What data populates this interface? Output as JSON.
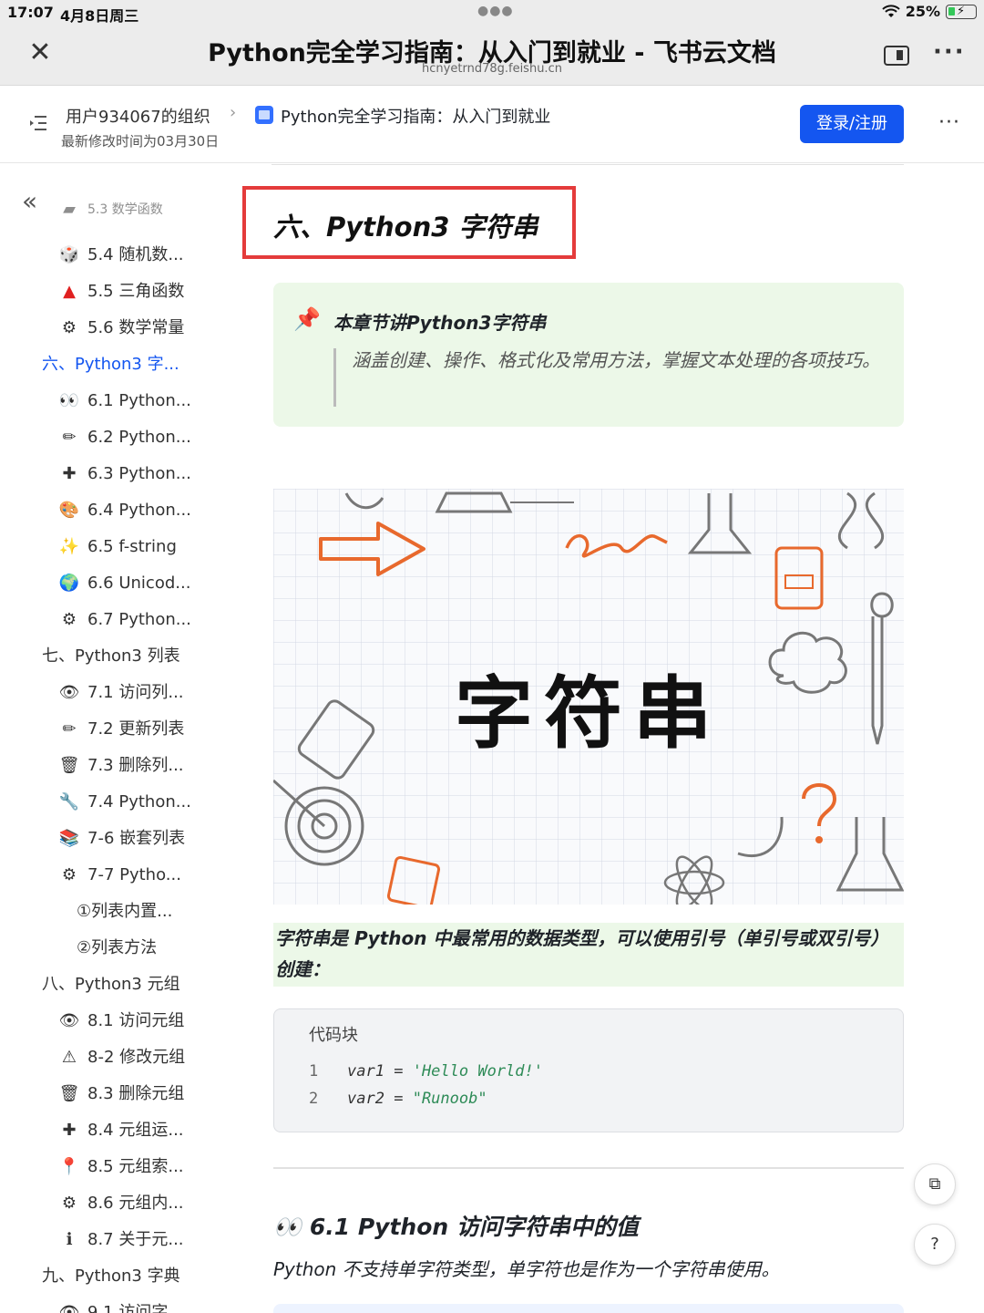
{
  "status_bar": {
    "time": "17:07",
    "date": "4月8日周三",
    "battery": "25%"
  },
  "window": {
    "title": "Python完全学习指南：从入门到就业 - 飞书云文档",
    "url": "hcnyetrnd78g.feishu.cn"
  },
  "doc_header": {
    "org": "用户934067的组织",
    "doc_name": "Python完全学习指南：从入门到就业",
    "modified": "最新修改时间为03月30日",
    "login": "登录/注册"
  },
  "sidebar": {
    "items": [
      {
        "icon": "🎲",
        "label": "5.4 随机数..."
      },
      {
        "icon": "▲",
        "label": "5.5 三角函数"
      },
      {
        "icon": "⚙",
        "label": "5.6 数学常量"
      },
      {
        "icon": "",
        "label": "六、Python3 字..."
      },
      {
        "icon": "👀",
        "label": "6.1 Python..."
      },
      {
        "icon": "✏",
        "label": "6.2 Python..."
      },
      {
        "icon": "✚",
        "label": "6.3 Python..."
      },
      {
        "icon": "🎨",
        "label": "6.4 Python..."
      },
      {
        "icon": "✨",
        "label": "6.5 f-string"
      },
      {
        "icon": "🌍",
        "label": "6.6 Unicod..."
      },
      {
        "icon": "⚙",
        "label": "6.7 Python..."
      },
      {
        "icon": "",
        "label": "七、Python3 列表"
      },
      {
        "icon": "👁",
        "label": "7.1 访问列..."
      },
      {
        "icon": "✏",
        "label": "7.2 更新列表"
      },
      {
        "icon": "🗑",
        "label": "7.3 删除列..."
      },
      {
        "icon": "🔧",
        "label": "7.4 Python..."
      },
      {
        "icon": "📚",
        "label": "7-6 嵌套列表"
      },
      {
        "icon": "⚙",
        "label": "7-7 Pytho..."
      },
      {
        "icon": "",
        "label": "①列表内置..."
      },
      {
        "icon": "",
        "label": "②列表方法"
      },
      {
        "icon": "",
        "label": "八、Python3 元组"
      },
      {
        "icon": "👁",
        "label": "8.1 访问元组"
      },
      {
        "icon": "⚠",
        "label": "8-2 修改元组"
      },
      {
        "icon": "🗑",
        "label": "8.3 删除元组"
      },
      {
        "icon": "✚",
        "label": "8.4 元组运..."
      },
      {
        "icon": "📍",
        "label": "8.5 元组索..."
      },
      {
        "icon": "⚙",
        "label": "8.6 元组内..."
      },
      {
        "icon": "ℹ",
        "label": "8.7 关于元..."
      },
      {
        "icon": "",
        "label": "九、Python3 字典"
      },
      {
        "icon": "👁",
        "label": "9.1 访问字..."
      }
    ]
  },
  "content": {
    "heading": "六、Python3 字符串",
    "callout_title": "本章节讲Python3字符串",
    "callout_quote": "涵盖创建、操作、格式化及常用方法，掌握文本处理的各项技巧。",
    "hero_text": "字符串",
    "para_highlight": "字符串是 Python 中最常用的数据类型，可以使用引号（单引号或双引号）创建：",
    "code_label": "代码块",
    "code": [
      {
        "ln": "1",
        "var": "var1",
        "op": "=",
        "str": "'Hello World!'"
      },
      {
        "ln": "2",
        "var": "var2",
        "op": "=",
        "str": "\"Runoob\""
      }
    ],
    "h2": "👀 6.1 Python 访问字符串中的值",
    "para2": "Python 不支持单字符类型，单字符也是作为一个字符串使用。"
  },
  "colors": {
    "accent": "#1456f0",
    "highlight_bg": "#ecf8e8",
    "box_red": "#e43b3b"
  }
}
